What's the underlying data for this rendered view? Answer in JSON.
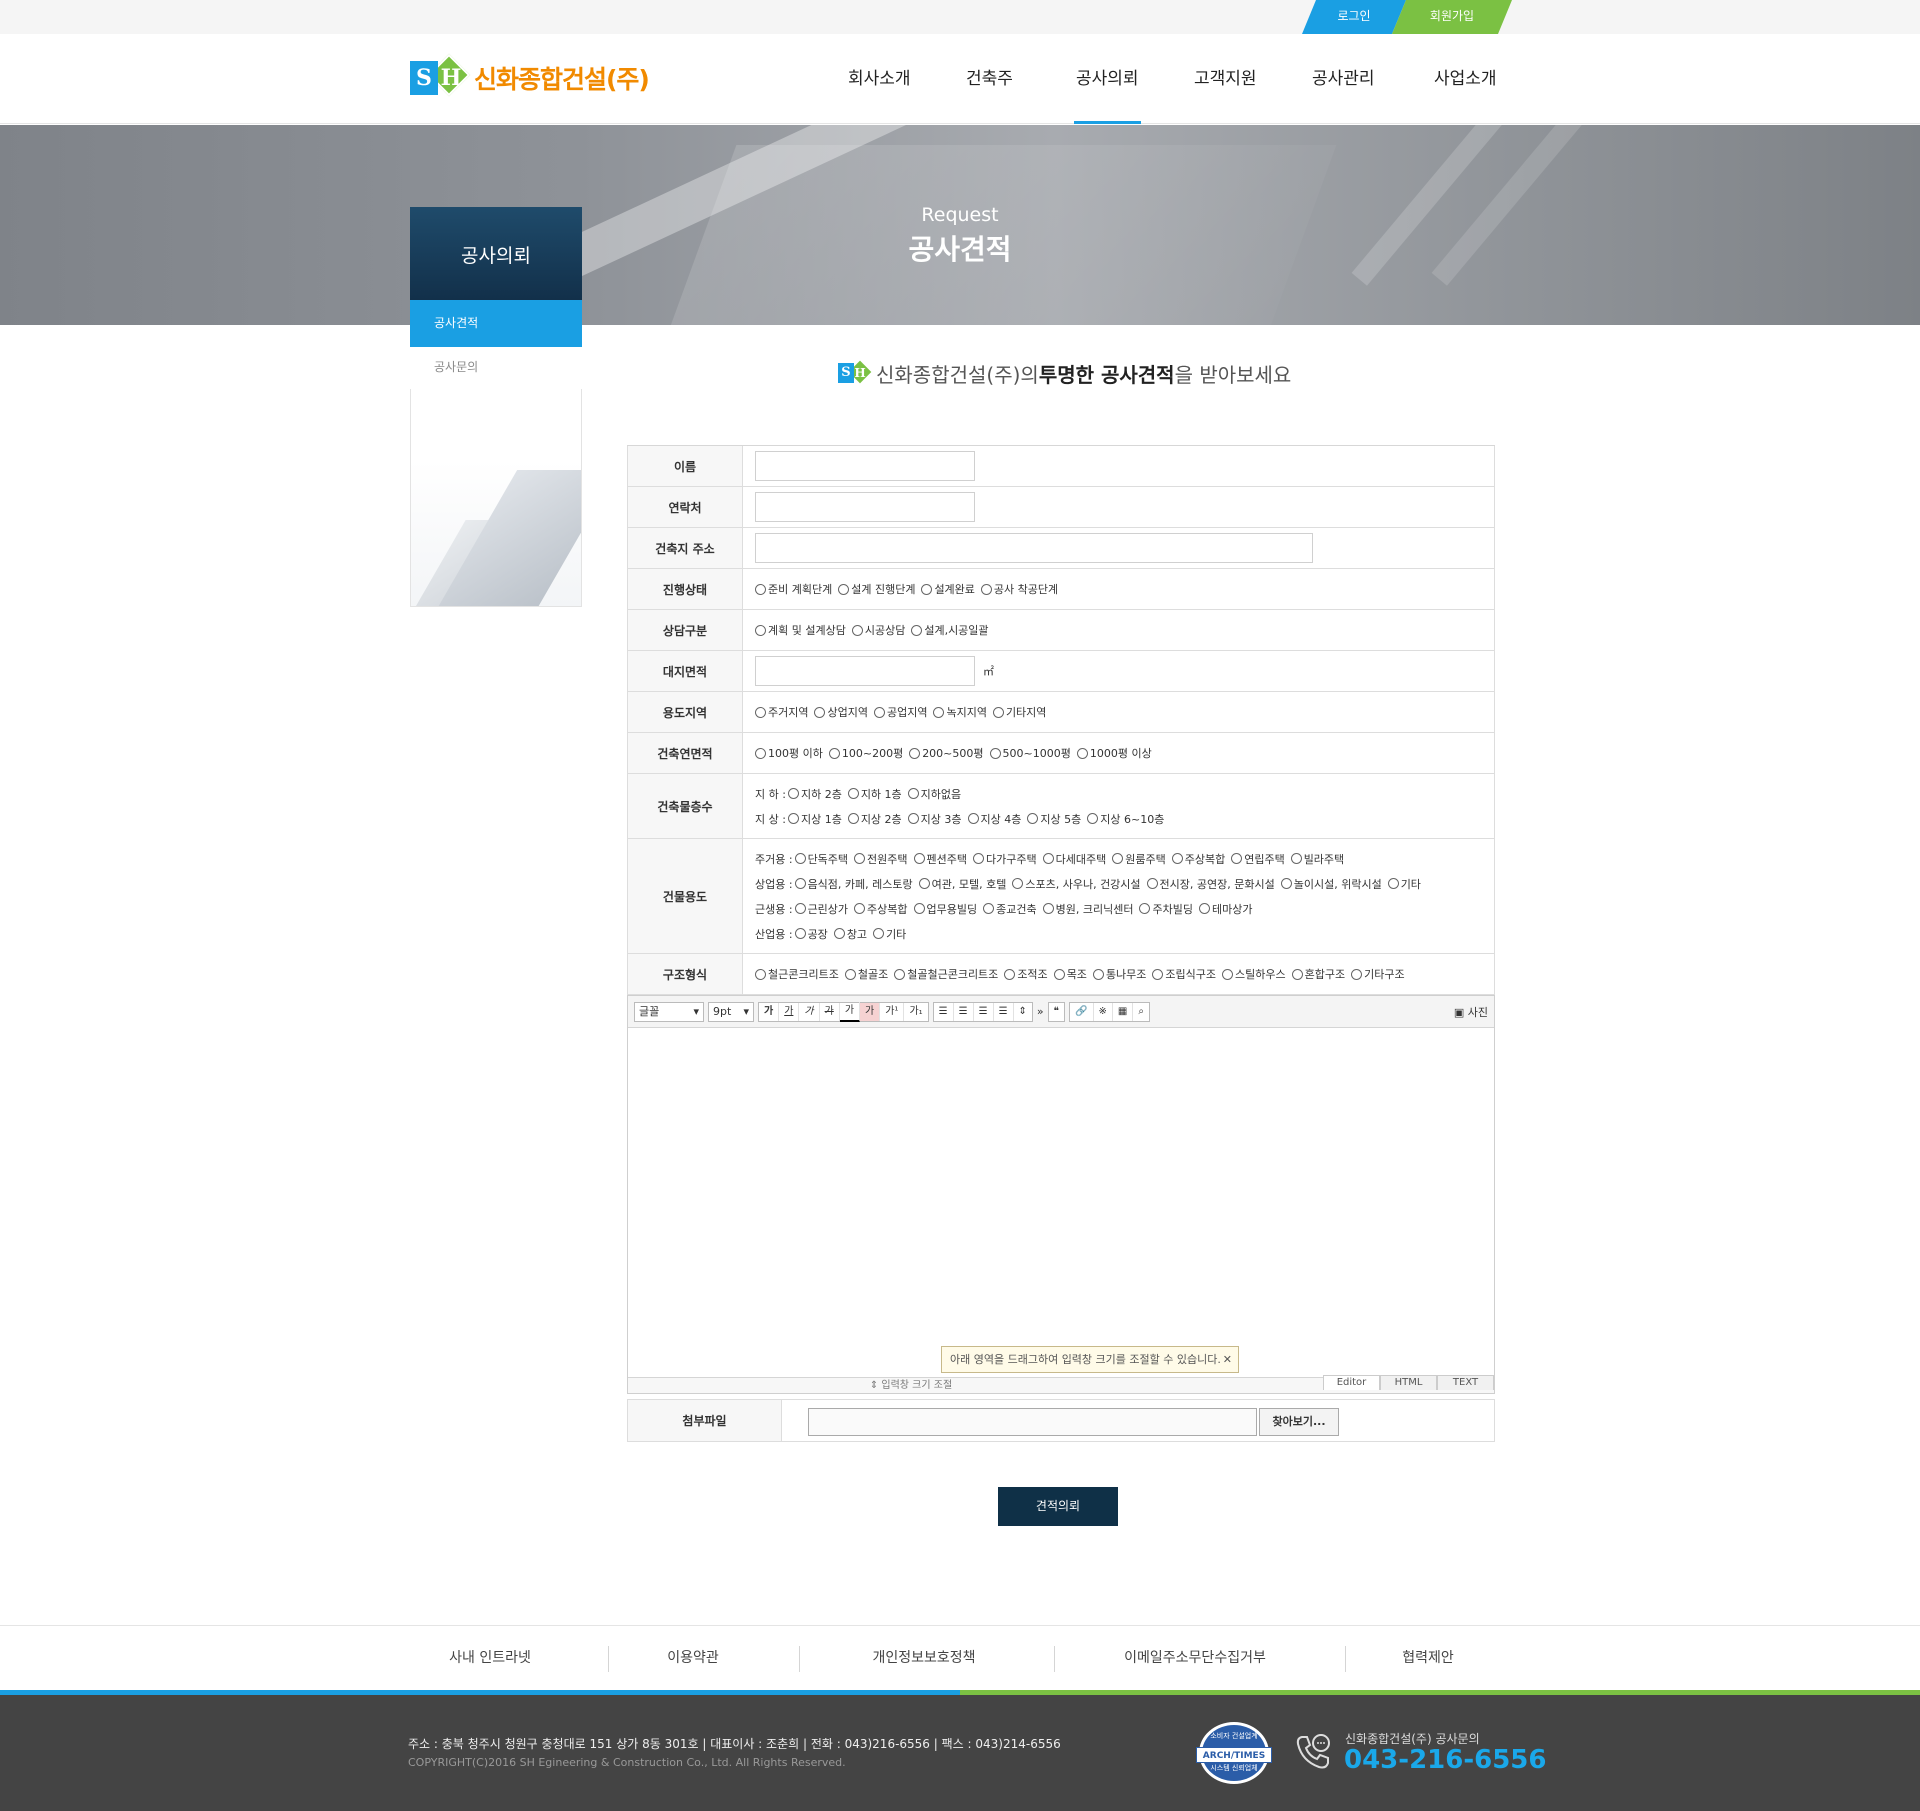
{
  "top_links": {
    "login": "로그인",
    "join": "회원가입"
  },
  "logo": {
    "mark_s": "S",
    "mark_h": "H",
    "text": "신화종합건설(주)"
  },
  "nav": [
    "회사소개",
    "건축주",
    "공사의뢰",
    "고객지원",
    "공사관리",
    "사업소개"
  ],
  "nav_active": "공사의뢰",
  "banner": {
    "subtitle": "Request",
    "title": "공사견적"
  },
  "lnb": {
    "title": "공사의뢰",
    "items": [
      "공사견적",
      "공사문의"
    ]
  },
  "intro": {
    "pre": "신화종합건설(주)의 ",
    "bold": "투명한 공사견적",
    "post": "을 받아보세요"
  },
  "form": {
    "name_label": "이름",
    "contact_label": "연락처",
    "address_label": "건축지 주소",
    "progress_label": "진행상태",
    "progress_options": [
      "준비 계획단계",
      "설계 진행단계",
      "설계완료",
      "공사 착공단계"
    ],
    "consult_label": "상담구분",
    "consult_options": [
      "계획 및 설계상담",
      "시공상담",
      "설계,시공일괄"
    ],
    "land_label": "대지면적",
    "land_unit": "㎡",
    "zone_label": "용도지역",
    "zone_options": [
      "주거지역",
      "상업지역",
      "공업지역",
      "녹지지역",
      "기타지역"
    ],
    "floor_area_label": "건축연면적",
    "floor_area_options": [
      "100평 이하",
      "100~200평",
      "200~500평",
      "500~1000평",
      "1000평 이상"
    ],
    "stories_label": "건축물층수",
    "stories_below_label": "지  하 :",
    "stories_below": [
      "지하 2층",
      "지하 1층",
      "지하없음"
    ],
    "stories_above_label": "지  상 :",
    "stories_above": [
      "지상 1층",
      "지상 2층",
      "지상 3층",
      "지상 4층",
      "지상 5층",
      "지상 6~10층"
    ],
    "use_label": "건물용도",
    "use_groups": [
      {
        "label": "주거용 :",
        "options": [
          "단독주택",
          "전원주택",
          "펜션주택",
          "다가구주택",
          "다세대주택",
          "원룸주택",
          "주상복합",
          "연립주택",
          "빌라주택"
        ]
      },
      {
        "label": "상업용 :",
        "options": [
          "음식점, 카페, 레스토랑",
          "여관, 모텔, 호텔",
          "스포츠, 사우나, 건강시설",
          "전시장, 공연장, 문화시설",
          "놀이시설, 위락시설",
          "기타"
        ]
      },
      {
        "label": "근생용 :",
        "options": [
          "근린상가",
          "주상복합",
          "업무용빌딩",
          "종교건축",
          "병원, 크리닉센터",
          "주차빌딩",
          "테마상가"
        ]
      },
      {
        "label": "산업용 :",
        "options": [
          "공장",
          "창고",
          "기타"
        ]
      }
    ],
    "structure_label": "구조형식",
    "structure_options": [
      "철근콘크리트조",
      "철골조",
      "철골철근콘크리트조",
      "조적조",
      "목조",
      "통나무조",
      "조립식구조",
      "스틸하우스",
      "혼합구조",
      "기타구조"
    ]
  },
  "editor": {
    "font_select": "글꼴",
    "size_select": "9pt",
    "format_buttons": [
      "가",
      "가",
      "가",
      "가",
      "가",
      "가",
      "가¹",
      "가₁"
    ],
    "photo": "사진",
    "tip": "아래 영역을 드래그하여 입력창 크기를 조절할 수 있습니다.",
    "resize_label": "⇕ 입력창 크기 조절",
    "modes": [
      "Editor",
      "HTML",
      "TEXT"
    ]
  },
  "file": {
    "label": "첨부파일",
    "button": "찾아보기..."
  },
  "submit": "견적의뢰",
  "footer_nav": [
    "사내 인트라넷",
    "이용약관",
    "개인정보보호정책",
    "이메일주소무단수집거부",
    "협력제안"
  ],
  "footer": {
    "address": "주소 : 충북 청주시 청원구 충청대로 151 상가 8동 301호   |   대표이사 : 조춘희   |   전화 : 043)216-6556   |   팩스 : 043)214-6556",
    "copyright": "COPYRIGHT(C)2016  SH Egineering & Construction  Co., Ltd. All Rights Reserved.",
    "badge_top": "소비자 건설업계",
    "badge_main": "ARCH/TIMES",
    "badge_bottom": "시스템 신뢰업체",
    "contact_label": "신화종합건설(주) 공사문의",
    "phone": "043-216-6556"
  },
  "colors": {
    "accent_blue": "#1a9fe3",
    "accent_green": "#7bc143",
    "logo_orange": "#f18a00",
    "navy": "#0f3047"
  }
}
